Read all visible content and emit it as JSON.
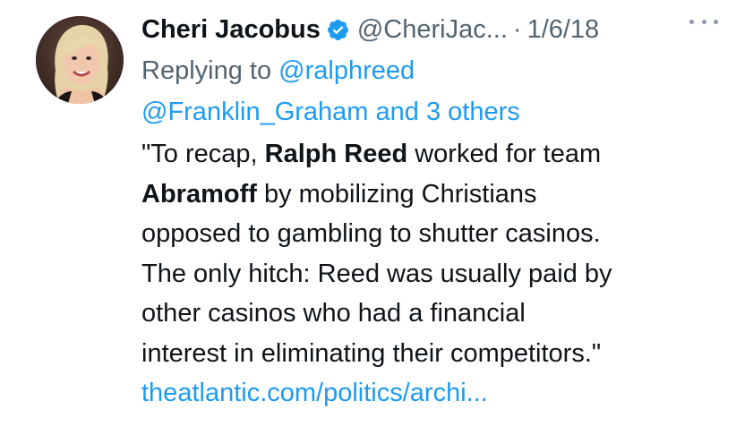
{
  "author": {
    "display_name": "Cheri Jacobus",
    "handle": "@CheriJac...",
    "separator": "·",
    "date": "1/6/18",
    "verified": true,
    "verified_color": "#1d9bf0"
  },
  "reply": {
    "prefix": "Replying to",
    "mention_1": "@ralphreed",
    "mention_2": "@Franklin_Graham and 3 others"
  },
  "body": {
    "line1_a": "\"To recap, ",
    "line1_b": "Ralph Reed",
    "line1_c": " worked for team",
    "line2_a": "Abramoff",
    "line2_b": " by mobilizing Christians",
    "line3": "opposed to gambling to shutter casinos.",
    "line4": "The only hitch: Reed was usually paid by",
    "line5": "other casinos who had a financial",
    "line6": "interest in eliminating their competitors.\"",
    "link": "theatlantic.com/politics/archi..."
  },
  "icons": {
    "verified": "verified-badge-icon",
    "more": "more-options-icon"
  },
  "colors": {
    "text": "#0f1419",
    "secondary": "#536471",
    "accent": "#1d9bf0"
  }
}
